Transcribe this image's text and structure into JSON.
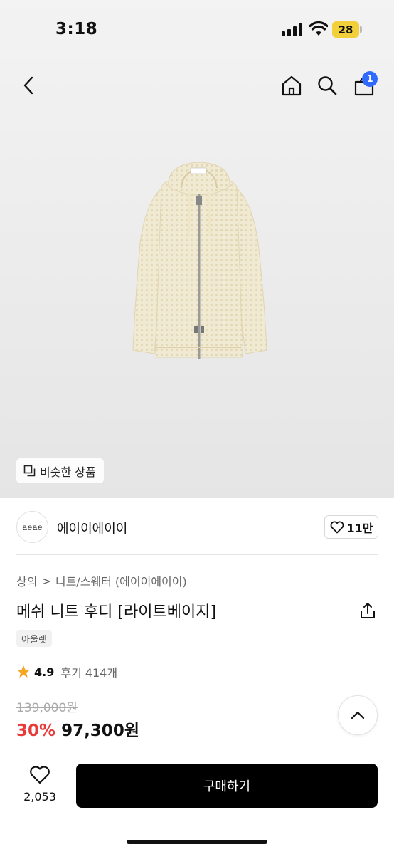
{
  "status_bar": {
    "time": "3:18",
    "battery": "28"
  },
  "nav": {
    "cart_badge": "1",
    "icons": [
      "back-icon",
      "home-icon",
      "search-icon",
      "cart-icon"
    ]
  },
  "product_image": {
    "similar_label": "비슷한 상품"
  },
  "brand": {
    "logo_text": "aeae",
    "name": "에이이에이이",
    "likes": "11만"
  },
  "breadcrumb": {
    "category": "상의",
    "separator": ">",
    "subcategory": "니트/스웨터 (에이이에이이)"
  },
  "product": {
    "title": "메쉬 니트 후디 [라이트베이지]",
    "tag": "아울렛",
    "rating": "4.9",
    "reviews": "후기 414개",
    "original_price": "139,000원",
    "discount": "30%",
    "price": "97,300원"
  },
  "bottom_bar": {
    "wish_count": "2,053",
    "buy_label": "구매하기"
  },
  "colors": {
    "accent_blue": "#2f6bff",
    "discount_red": "#e83a3a",
    "star": "#f5a623",
    "buy_button": "#000000"
  }
}
